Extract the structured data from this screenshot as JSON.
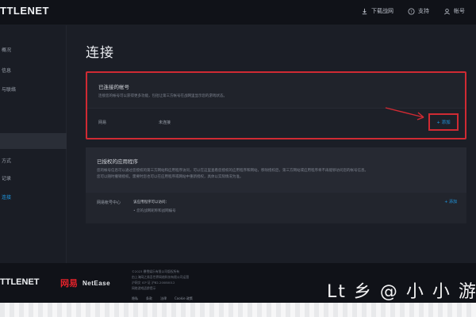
{
  "topbar": {
    "logo": "TTLENET",
    "actions": [
      {
        "icon": "download-icon",
        "label": "下载战网"
      },
      {
        "icon": "help-icon",
        "label": "支持"
      },
      {
        "icon": "user-icon",
        "label": "帐号"
      }
    ]
  },
  "sidebar": {
    "items": [
      {
        "label": "概况",
        "active": false
      },
      {
        "label": "信息",
        "active": false
      },
      {
        "label": "与联络",
        "active": false
      },
      {
        "label": "方式",
        "active": false
      },
      {
        "label": "记录",
        "active": false
      },
      {
        "label": "连接",
        "active": true
      }
    ]
  },
  "main": {
    "title": "连接",
    "connected": {
      "title": "已连接的帐号",
      "description": "连接您的帐号可以获得更多功能，包括让第三方帐号在战网里显示您的游戏状态。",
      "row_label": "网易",
      "row_status": "未连接",
      "add_label": "+ 添加"
    },
    "authorized": {
      "title": "已授权的应用程序",
      "description_1": "您的帐号信息可以通过您授权的第三方网站和应用程序访问，可以在这里查看您授权的应用程序和网站，移除授权后，第三方网站或应用程序将不再能够访问您的帐号信息。",
      "description_2": "您可以随时撤销授权。需要时您也可以在应用程序或网站中重新授权，具体以实际情况为准。",
      "row_label": "网易帐号中心",
      "row_sub_1": "该应用程序可以访问：",
      "row_sub_2": "• 您的战网昵称和战网编号",
      "add_label": "+ 添加"
    }
  },
  "footer": {
    "logo": "TTLENET",
    "netease_cn": "网易",
    "netease_en": "NetEase",
    "lines": [
      "©2023 暴雪娱乐有限公司版权所有",
      "由上海网之易吾世界网络科技有限公司运营",
      "沪网文 ICP 证 沪B2-20080012",
      "网络游戏适龄提示"
    ],
    "links": [
      "隐私",
      "条款",
      "法律",
      "Cookie 政策"
    ],
    "watermark": "Lt 乡 @ 小 小 游"
  },
  "colors": {
    "accent": "#1f9be6",
    "highlight_red": "#d02a33"
  }
}
